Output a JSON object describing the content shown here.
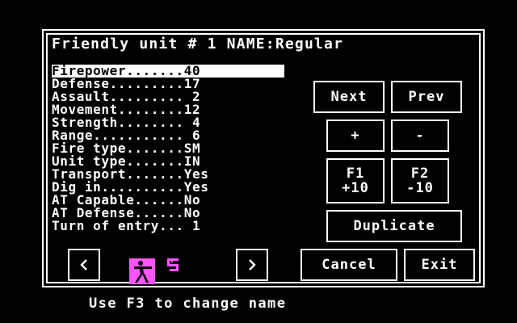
{
  "title": "Friendly unit # 1 NAME:Regular",
  "stats": [
    {
      "label": "Firepower.......",
      "value": "40",
      "selected": true
    },
    {
      "label": "Defense.........",
      "value": "17"
    },
    {
      "label": "Assault.........",
      "value": " 2"
    },
    {
      "label": "Movement........",
      "value": "12"
    },
    {
      "label": "Strength........",
      "value": " 4"
    },
    {
      "label": "Range...........",
      "value": " 6"
    },
    {
      "label": "Fire type.......",
      "value": "SM"
    },
    {
      "label": "Unit type.......",
      "value": "IN"
    },
    {
      "label": "Transport.......",
      "value": "Yes"
    },
    {
      "label": "Dig in..........",
      "value": "Yes"
    },
    {
      "label": "AT Capable......",
      "value": "No"
    },
    {
      "label": "AT Defense......",
      "value": "No"
    },
    {
      "label": "Turn of entry...",
      "value": " 1"
    }
  ],
  "buttons": {
    "next": "Next",
    "prev": "Prev",
    "plus": "+",
    "minus": "-",
    "f1": "F1\n+10",
    "f2": "F2\n-10",
    "duplicate": "Duplicate",
    "left_arrow": "<",
    "right_arrow": ">",
    "cancel": "Cancel",
    "exit": "Exit"
  },
  "hint": "Use F3 to change name",
  "colors": {
    "background": "#000000",
    "foreground": "#ffffff",
    "accent": "#ff55ff"
  },
  "icons": {
    "unit": "infantry-soldier-icon",
    "marker": "unit-marker-icon"
  }
}
